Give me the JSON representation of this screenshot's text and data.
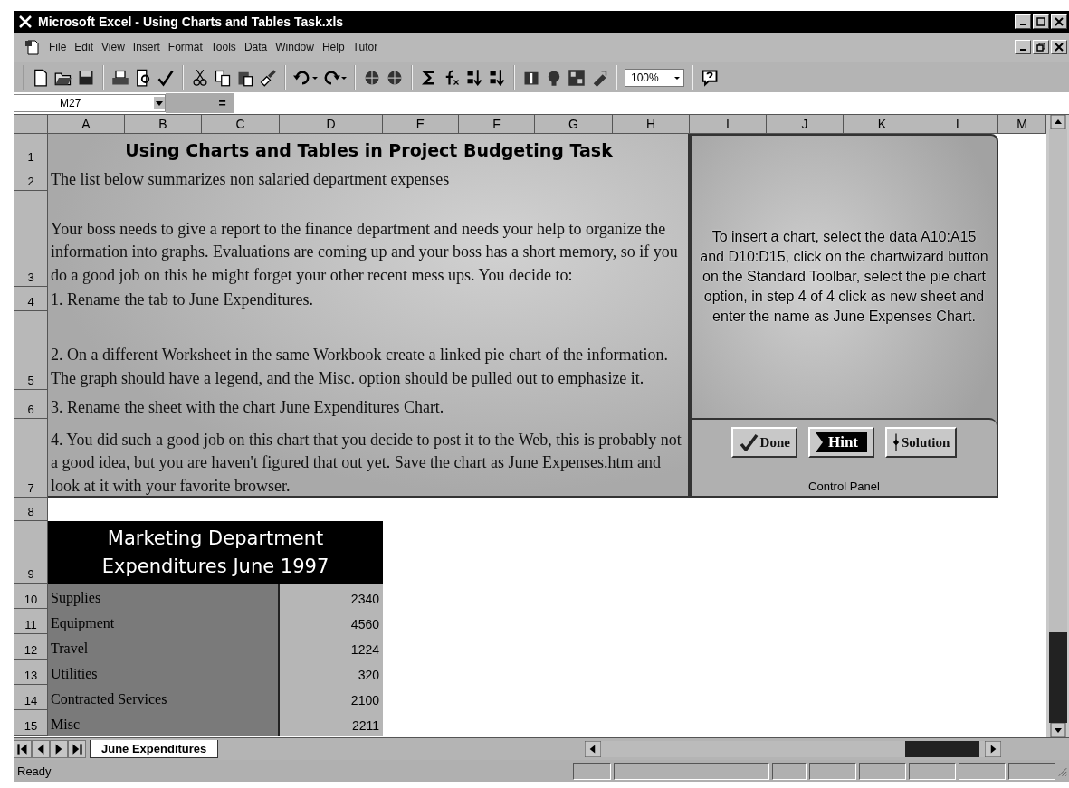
{
  "window": {
    "title": "Microsoft Excel - Using Charts and Tables Task.xls"
  },
  "menu_bar": {
    "items": [
      "File",
      "Edit",
      "View",
      "Insert",
      "Format",
      "Tools",
      "Data",
      "Window",
      "Help",
      "Tutor"
    ]
  },
  "toolbar": {
    "zoom": "100%"
  },
  "formula_bar": {
    "name_box": "M27",
    "equals": "="
  },
  "columns": [
    "A",
    "B",
    "C",
    "D",
    "E",
    "F",
    "G",
    "H",
    "I",
    "J",
    "K",
    "L",
    "M"
  ],
  "rows": [
    "1",
    "2",
    "3",
    "4",
    "5",
    "6",
    "7",
    "8",
    "9",
    "10",
    "11",
    "12",
    "13",
    "14",
    "15"
  ],
  "task": {
    "title": "Using Charts and Tables in Project Budgeting Task",
    "lines": [
      "The list below summarizes non salaried department expenses",
      "Your boss needs to give a report to the finance department and needs your help to organize the information into graphs.  Evaluations are coming up and your boss has a short memory, so if you do a good job on this he might forget your other recent mess ups.  You decide to:",
      "1. Rename the tab to June Expenditures.",
      "2. On a different Worksheet in the same Workbook create a linked pie chart of the information. The graph should have a legend, and the Misc. option should be pulled out to emphasize it.",
      "3. Rename the sheet with the chart June Expenditures Chart.",
      "4. You did such a good job on this chart that you decide to post it to the Web, this is probably not a good idea, but you are haven't figured that out yet.  Save the chart as June Expenses.htm and look at it with your favorite browser."
    ]
  },
  "panel": {
    "instructions": "To insert a chart, select the data A10:A15 and D10:D15, click on the chartwizard button on the Standard Toolbar, select the pie chart option, in step 4 of 4 click as new sheet and enter the name as June Expenses Chart.",
    "buttons": [
      {
        "kind": "done",
        "label": "Done"
      },
      {
        "kind": "hint",
        "label": "Hint"
      },
      {
        "kind": "solution",
        "label": "Solution"
      }
    ],
    "caption": "Control Panel"
  },
  "table": {
    "title": "Marketing Department Expenditures June 1997",
    "rows": [
      {
        "label": "Supplies",
        "value": "2340"
      },
      {
        "label": "Equipment",
        "value": "4560"
      },
      {
        "label": "Travel",
        "value": "1224"
      },
      {
        "label": "Utilities",
        "value": "320"
      },
      {
        "label": "Contracted Services",
        "value": "2100"
      },
      {
        "label": "Misc",
        "value": "2211"
      }
    ]
  },
  "sheet_tabs": [
    {
      "label": "June Expenditures",
      "selected": true
    }
  ],
  "status_bar": {
    "text": "Ready"
  }
}
